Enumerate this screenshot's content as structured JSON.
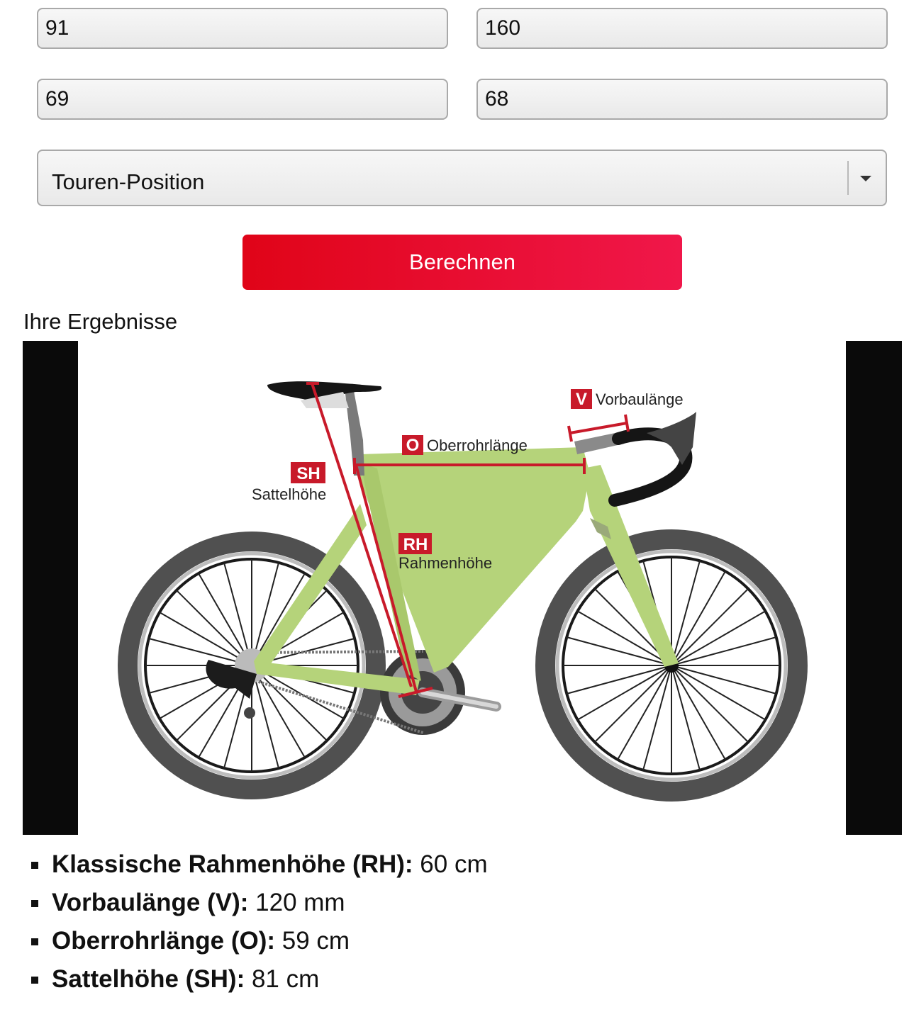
{
  "form": {
    "field_1": "91",
    "field_2": "160",
    "field_3": "69",
    "field_4": "68",
    "position_select": "Touren-Position",
    "submit_label": "Berechnen"
  },
  "results": {
    "heading": "Ihre Ergebnisse",
    "diagram_labels": {
      "v_badge": "V",
      "v_text": "Vorbaulänge",
      "o_badge": "O",
      "o_text": "Oberrohrlänge",
      "sh_badge": "SH",
      "sh_text": "Sattelhöhe",
      "rh_badge": "RH",
      "rh_text": "Rahmenhöhe"
    },
    "items": [
      {
        "label": "Klassische Rahmenhöhe (RH):",
        "value": "60 cm"
      },
      {
        "label": "Vorbaulänge (V):",
        "value": "120 mm"
      },
      {
        "label": "Oberrohrlänge (O):",
        "value": "59 cm"
      },
      {
        "label": "Sattelhöhe (SH):",
        "value": "81 cm"
      }
    ]
  },
  "colors": {
    "accent_red": "#e00418",
    "frame_green": "#b5d37a",
    "measure_red": "#c81a2a"
  }
}
